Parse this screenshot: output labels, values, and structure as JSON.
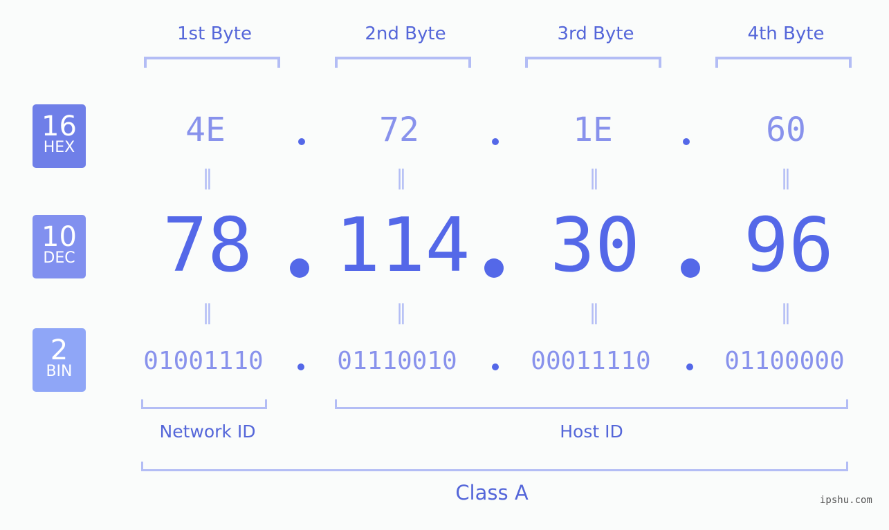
{
  "bases": [
    {
      "num": "16",
      "label": "HEX",
      "color": "#6f7fe8"
    },
    {
      "num": "10",
      "label": "DEC",
      "color": "#8190ef"
    },
    {
      "num": "2",
      "label": "BIN",
      "color": "#8fa6f7"
    }
  ],
  "bytes": [
    {
      "header": "1st Byte",
      "hex": "4E",
      "dec": "78",
      "bin": "01001110"
    },
    {
      "header": "2nd Byte",
      "hex": "72",
      "dec": "114",
      "bin": "01110010"
    },
    {
      "header": "3rd Byte",
      "hex": "1E",
      "dec": "30",
      "bin": "00011110"
    },
    {
      "header": "4th Byte",
      "hex": "60",
      "dec": "96",
      "bin": "01100000"
    }
  ],
  "equals_symbol": "=",
  "network_id_label": "Network ID",
  "host_id_label": "Host ID",
  "class_label": "Class A",
  "watermark": "ipshu.com"
}
